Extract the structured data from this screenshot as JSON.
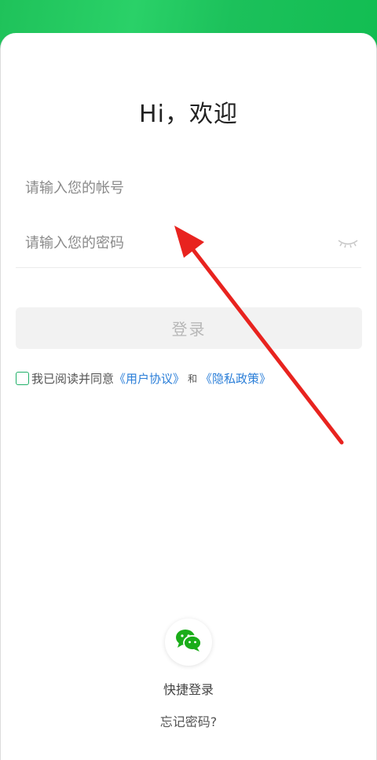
{
  "header": {
    "title": "Hi，欢迎"
  },
  "form": {
    "account_placeholder": "请输入您的帐号",
    "password_placeholder": "请输入您的密码",
    "login_label": "登录"
  },
  "agreement": {
    "prefix": "我已阅读并同意",
    "user_agreement": "《用户协议》",
    "and": "和",
    "privacy_policy": "《隐私政策》"
  },
  "footer": {
    "quick_login_label": "快捷登录",
    "forgot_password": "忘记密码?"
  },
  "colors": {
    "brand_green": "#1fc25a",
    "link_blue": "#2a7ed8",
    "annotation_red": "#e8231f",
    "wechat_green": "#1aad19"
  },
  "icons": {
    "password_toggle": "eye-closed-icon",
    "quick_login": "wechat-icon"
  }
}
